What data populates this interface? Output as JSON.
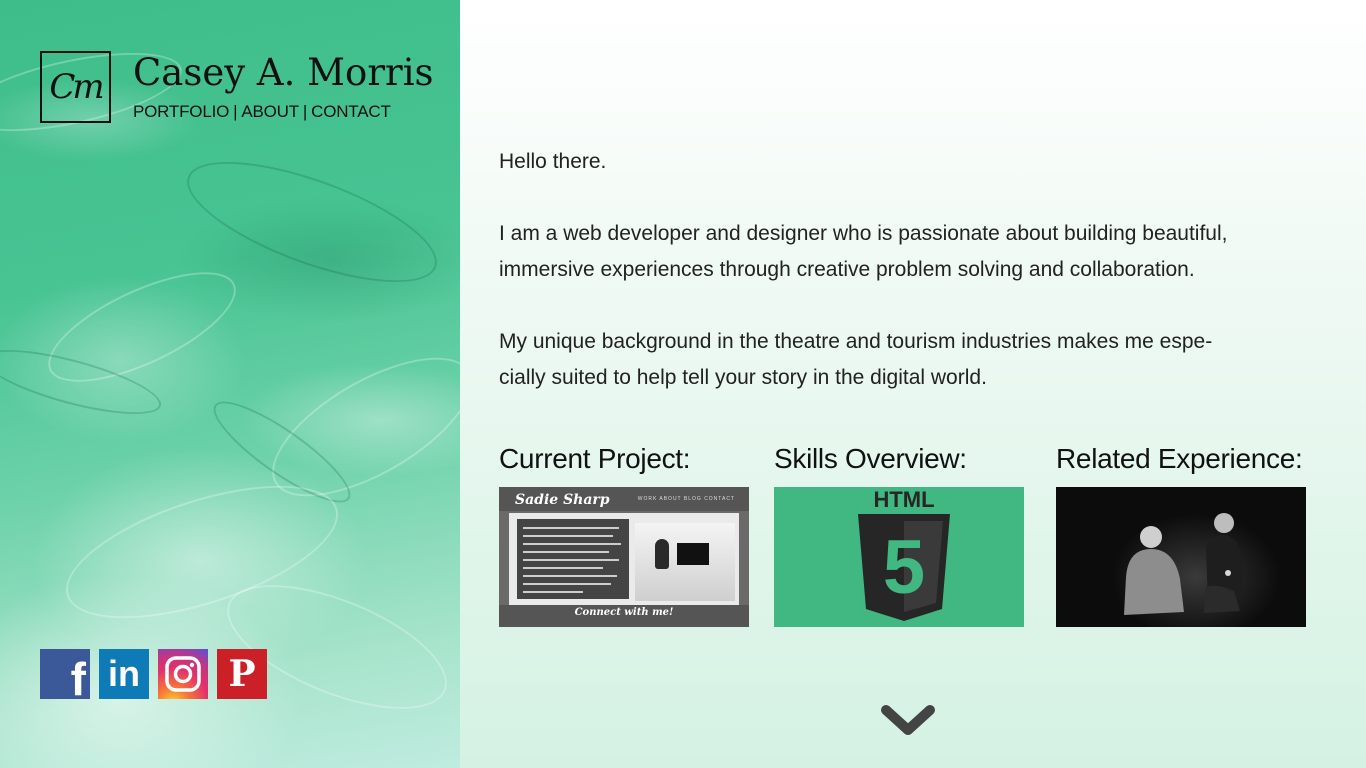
{
  "brand": {
    "logo_text": "Cm",
    "name": "Casey A. Morris"
  },
  "nav": {
    "items": [
      "PORTFOLIO",
      "ABOUT",
      "CONTACT"
    ],
    "separator": "|"
  },
  "social": {
    "items": [
      {
        "name": "facebook",
        "glyph": "f",
        "color": "#3b5998"
      },
      {
        "name": "linkedin",
        "glyph": "in",
        "color": "#0f7bb6"
      },
      {
        "name": "instagram",
        "color": "#e1306c"
      },
      {
        "name": "pinterest",
        "glyph": "P",
        "color": "#cb2027"
      }
    ]
  },
  "intro": {
    "greeting": "Hello there.",
    "paragraph1_line1": "I am a web developer and designer who is passionate about building beautiful,",
    "paragraph1_line2": "immersive experiences through creative problem solving and collaboration.",
    "paragraph2_line1": "My unique background in the theatre and tourism industries makes me espe-",
    "paragraph2_line2": "cially suited to help tell your story in the digital world."
  },
  "cards": [
    {
      "title": "Current Project:",
      "thumb": {
        "logo": "Sadie Sharp",
        "nav": "WORK   ABOUT   BLOG   CONTACT",
        "footer": "Connect with me!"
      }
    },
    {
      "title": "Skills Overview:",
      "thumb": {
        "label": "HTML",
        "number": "5",
        "bg_color": "#41b782",
        "shield_color": "#262626"
      }
    },
    {
      "title": "Related Experience:",
      "thumb": {
        "icon": "theatre-photo"
      }
    }
  ],
  "scroll_icon": "chevron-down-icon",
  "colors": {
    "accent": "#41b782",
    "text": "#222222",
    "chevron": "#444444"
  }
}
